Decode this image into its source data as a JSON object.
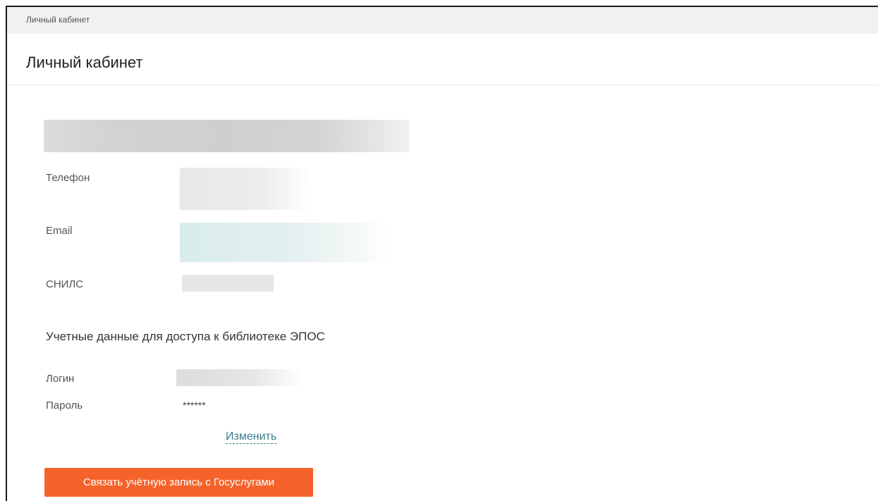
{
  "breadcrumb": {
    "current": "Личный кабинет"
  },
  "header": {
    "title": "Личный кабинет"
  },
  "profile": {
    "phone_label": "Телефон",
    "email_label": "Email",
    "snils_label": "СНИЛС"
  },
  "library_credentials": {
    "section_title": "Учетные данные для доступа к библиотеке ЭПОС",
    "login_label": "Логин",
    "password_label": "Пароль",
    "password_value": "******",
    "change_link": "Изменить"
  },
  "actions": {
    "gosuslugi_button": "Связать учётную запись с Госуслугами"
  },
  "colors": {
    "accent_button": "#f5632a",
    "link": "#3a7c8c",
    "breadcrumb_bar": "#f2f1ef"
  }
}
